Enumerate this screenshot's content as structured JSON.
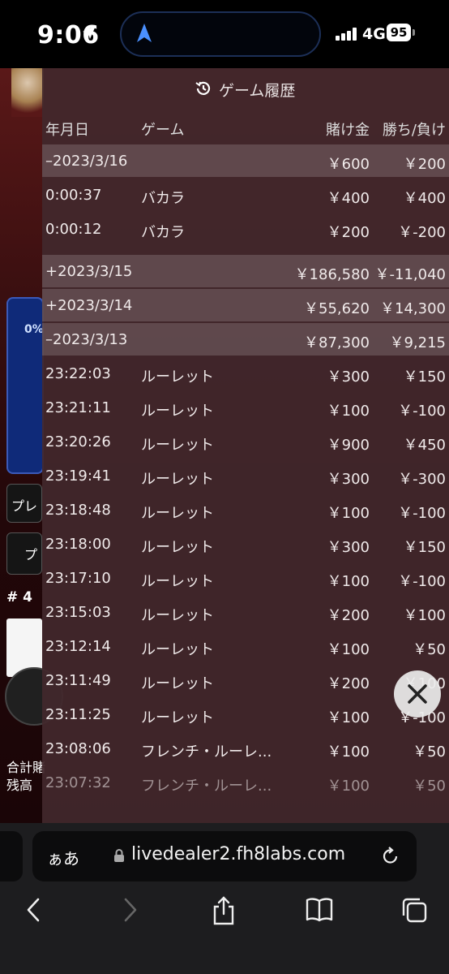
{
  "status_bar": {
    "time": "9:06",
    "network": "4G",
    "battery": "95"
  },
  "background": {
    "percent": "0%",
    "button1": "プレ",
    "button2": "プ",
    "hash": "# 4",
    "total_label": "合計賭",
    "balance_label": "残高"
  },
  "history": {
    "title": "ゲーム履歴",
    "columns": {
      "date": "年月日",
      "game": "ゲーム",
      "bet": "賭け金",
      "win": "勝ち/負け"
    },
    "rows": [
      {
        "type": "date",
        "date": "–2023/3/16",
        "bet": "￥600",
        "win": "￥200"
      },
      {
        "type": "entry",
        "date": "0:00:37",
        "game": "バカラ",
        "bet": "￥400",
        "win": "￥400"
      },
      {
        "type": "entry",
        "date": "0:00:12",
        "game": "バカラ",
        "bet": "￥200",
        "win": "￥-200"
      },
      {
        "type": "date",
        "date": "+2023/3/15",
        "bet": "￥186,580",
        "win": "￥-11,040"
      },
      {
        "type": "date",
        "date": "+2023/3/14",
        "bet": "￥55,620",
        "win": "￥14,300"
      },
      {
        "type": "date",
        "date": "–2023/3/13",
        "bet": "￥87,300",
        "win": "￥9,215"
      },
      {
        "type": "entry",
        "date": "23:22:03",
        "game": "ルーレット",
        "bet": "￥300",
        "win": "￥150"
      },
      {
        "type": "entry",
        "date": "23:21:11",
        "game": "ルーレット",
        "bet": "￥100",
        "win": "￥-100"
      },
      {
        "type": "entry",
        "date": "23:20:26",
        "game": "ルーレット",
        "bet": "￥900",
        "win": "￥450"
      },
      {
        "type": "entry",
        "date": "23:19:41",
        "game": "ルーレット",
        "bet": "￥300",
        "win": "￥-300"
      },
      {
        "type": "entry",
        "date": "23:18:48",
        "game": "ルーレット",
        "bet": "￥100",
        "win": "￥-100"
      },
      {
        "type": "entry",
        "date": "23:18:00",
        "game": "ルーレット",
        "bet": "￥300",
        "win": "￥150"
      },
      {
        "type": "entry",
        "date": "23:17:10",
        "game": "ルーレット",
        "bet": "￥100",
        "win": "￥-100"
      },
      {
        "type": "entry",
        "date": "23:15:03",
        "game": "ルーレット",
        "bet": "￥200",
        "win": "￥100"
      },
      {
        "type": "entry",
        "date": "23:12:14",
        "game": "ルーレット",
        "bet": "￥100",
        "win": "￥50"
      },
      {
        "type": "entry",
        "date": "23:11:49",
        "game": "ルーレット",
        "bet": "￥200",
        "win": "￥100"
      },
      {
        "type": "entry",
        "date": "23:11:25",
        "game": "ルーレット",
        "bet": "￥100",
        "win": "￥-100"
      },
      {
        "type": "entry",
        "date": "23:08:06",
        "game": "フレンチ・ルーレ...",
        "bet": "￥100",
        "win": "￥50"
      },
      {
        "type": "entry",
        "date": "23:07:32",
        "game": "フレンチ・ルーレ...",
        "bet": "￥100",
        "win": "￥50",
        "faded": true
      }
    ]
  },
  "browser": {
    "aa_label": "ぁあ",
    "url": "livedealer2.fh8labs.com"
  }
}
